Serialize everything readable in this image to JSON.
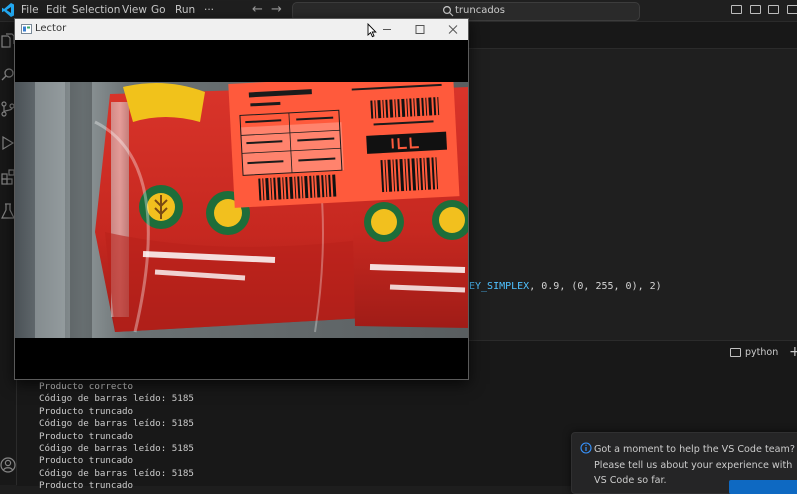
{
  "menubar": {
    "items": [
      "File",
      "Edit",
      "Selection",
      "View",
      "Go",
      "Run",
      "···"
    ],
    "back_icon": "arrow-left-icon",
    "forward_icon": "arrow-right-icon",
    "search_text": "truncados"
  },
  "activitybar": {
    "icons": [
      "explorer-icon",
      "search-icon",
      "source-control-icon",
      "run-debug-icon",
      "extensions-icon",
      "testing-icon",
      "account-icon"
    ]
  },
  "editor": {
    "code_prefix": "EY_SIMPLEX",
    "code_args": ", 0.9, (0, 255, 0), 2)"
  },
  "terminal": {
    "shell_name": "python",
    "lines": [
      "Producto correcto",
      "Código de barras leído: 5185",
      "Producto truncado",
      "Código de barras leído: 5185",
      "Producto truncado",
      "Código de barras leído: 5185",
      "Producto truncado",
      "Código de barras leído: 5185",
      "Producto truncado"
    ]
  },
  "notification": {
    "message": "Got a moment to help the VS Code team? Please tell us about your experience with VS Code so far."
  },
  "lector_window": {
    "title": "Lector"
  },
  "colors": {
    "accent_blue": "#0e69c2",
    "label_orange": "#ff5a3c",
    "package_red": "#c8231d"
  }
}
